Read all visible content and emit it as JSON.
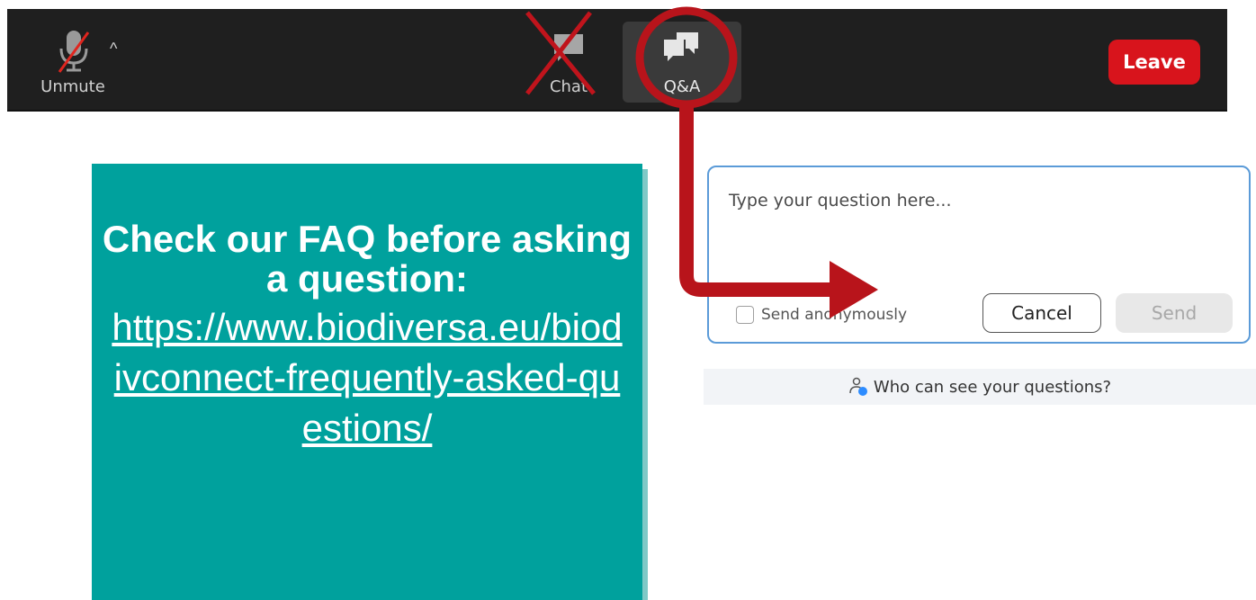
{
  "toolbar": {
    "unmute_label": "Unmute",
    "chat_label": "Chat",
    "qa_label": "Q&A",
    "leave_label": "Leave"
  },
  "faq": {
    "heading": "Check our FAQ before asking a question:",
    "link": "https://www.biodiversa.eu/biodivconnect-frequently-asked-questions/"
  },
  "qa_panel": {
    "placeholder": "Type your question here...",
    "anonymous_label": "Send anonymously",
    "cancel_label": "Cancel",
    "send_label": "Send",
    "who_label": "Who can see your questions?"
  },
  "colors": {
    "toolbar_bg": "#1f1f1f",
    "leave_red": "#d8141c",
    "annotation_red": "#c0141c",
    "faq_teal": "#00a19d",
    "panel_border": "#5b9bd8"
  },
  "icons": [
    "microphone-muted-icon",
    "caret-up-icon",
    "chat-icon",
    "qa-icon",
    "person-icon"
  ]
}
